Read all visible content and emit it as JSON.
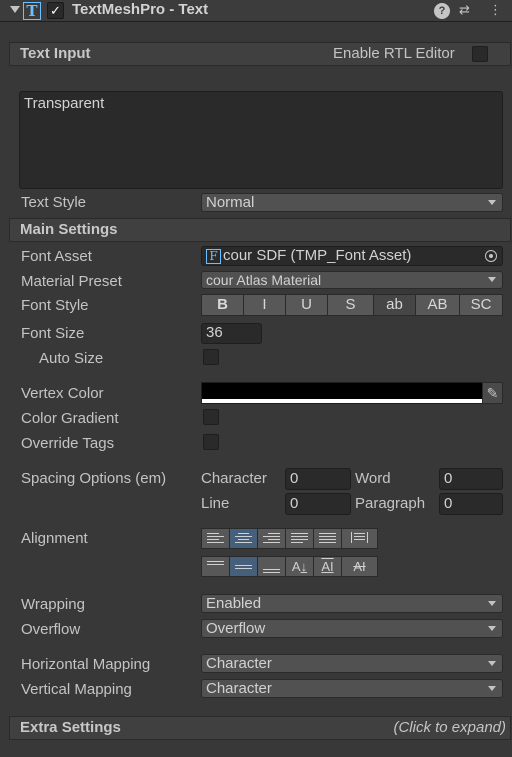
{
  "header": {
    "component_icon": "text-mesh-pro-icon",
    "enabled": true,
    "title": "TextMeshPro - Text",
    "help_icon": "help-icon",
    "presets_icon": "presets-icon",
    "menu_icon": "kebab-menu-icon"
  },
  "text_input": {
    "title": "Text Input",
    "rtl_label": "Enable RTL Editor",
    "rtl_checked": false,
    "text": "Transparent",
    "text_style_label": "Text Style",
    "text_style_value": "Normal"
  },
  "main_settings": {
    "title": "Main Settings",
    "font_asset_label": "Font Asset",
    "font_asset_icon": "F",
    "font_asset_value": "cour SDF (TMP_Font Asset)",
    "material_preset_label": "Material Preset",
    "material_preset_value": "cour Atlas Material",
    "font_style_label": "Font Style",
    "font_style_buttons": [
      "B",
      "I",
      "U",
      "S",
      "ab",
      "AB",
      "SC"
    ],
    "font_size_label": "Font Size",
    "font_size_value": "36",
    "auto_size_label": "Auto Size",
    "vertex_color_label": "Vertex Color",
    "vertex_color": "#000000",
    "color_gradient_label": "Color Gradient",
    "override_tags_label": "Override Tags",
    "spacing_label": "Spacing Options (em)",
    "character_label": "Character",
    "character_value": "0",
    "word_label": "Word",
    "word_value": "0",
    "line_label": "Line",
    "line_value": "0",
    "paragraph_label": "Paragraph",
    "paragraph_value": "0",
    "alignment_label": "Alignment",
    "horizontal_alignment_selected": "center",
    "vertical_alignment_selected": "middle",
    "wrapping_label": "Wrapping",
    "wrapping_value": "Enabled",
    "overflow_label": "Overflow",
    "overflow_value": "Overflow",
    "horizontal_mapping_label": "Horizontal Mapping",
    "horizontal_mapping_value": "Character",
    "vertical_mapping_label": "Vertical Mapping",
    "vertical_mapping_value": "Character"
  },
  "extra_settings": {
    "title": "Extra Settings",
    "hint": "(Click to expand)"
  },
  "colors": {
    "accent": "#46607c",
    "panel": "#383838"
  }
}
